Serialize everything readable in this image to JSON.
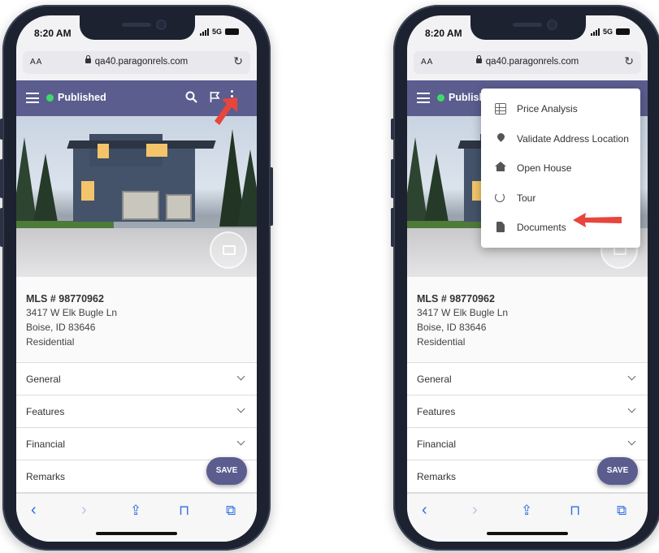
{
  "status": {
    "time": "8:20 AM",
    "network": "5G"
  },
  "browser": {
    "text_size_label": "AA",
    "url": "qa40.paragonrels.com",
    "reload_glyph": "↻"
  },
  "app": {
    "status_label": "Published",
    "status_color": "#3ddc6a",
    "brand_color": "#5b5d8f",
    "actions": [
      "search-icon",
      "flag-icon",
      "more-vert-icon"
    ]
  },
  "listing": {
    "mls": "MLS # 98770962",
    "address_line1": "3417 W Elk Bugle Ln",
    "address_line2": "Boise, ID 83646",
    "property_type": "Residential"
  },
  "sections": [
    "General",
    "Features",
    "Financial",
    "Remarks"
  ],
  "save_label": "SAVE",
  "toolbar": {
    "back": "‹",
    "forward": "›",
    "share": "⇪",
    "bookmarks": "⊓",
    "tabs": "⧉"
  },
  "menu": {
    "items": [
      {
        "label": "Price Analysis",
        "icon": "grid-icon"
      },
      {
        "label": "Validate Address Location",
        "icon": "location-pin-icon"
      },
      {
        "label": "Open House",
        "icon": "home-icon"
      },
      {
        "label": "Tour",
        "icon": "tour-icon"
      },
      {
        "label": "Documents",
        "icon": "document-icon"
      }
    ]
  },
  "annotation_color": "#e8453c"
}
